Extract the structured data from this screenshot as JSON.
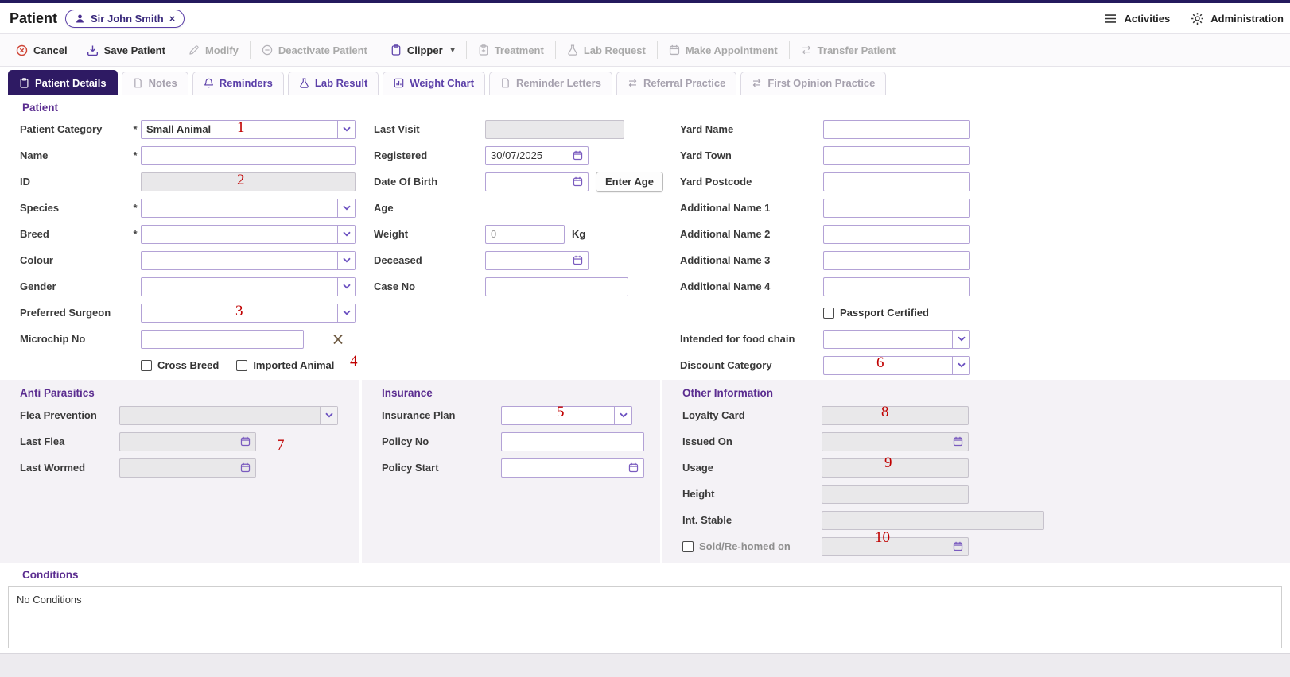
{
  "header": {
    "title": "Patient",
    "patient_chip": {
      "name": "Sir John Smith",
      "close_symbol": "×"
    },
    "activities_label": "Activities",
    "administration_label": "Administration"
  },
  "toolbar": {
    "cancel": "Cancel",
    "save_patient": "Save Patient",
    "modify": "Modify",
    "deactivate_patient": "Deactivate Patient",
    "clipper": "Clipper",
    "clipper_caret": "▾",
    "treatment": "Treatment",
    "lab_request": "Lab Request",
    "make_appointment": "Make Appointment",
    "transfer_patient": "Transfer Patient"
  },
  "tabs": {
    "patient_details": "Patient Details",
    "notes": "Notes",
    "reminders": "Reminders",
    "lab_result": "Lab Result",
    "weight_chart": "Weight Chart",
    "reminder_letters": "Reminder Letters",
    "referral_practice": "Referral Practice",
    "first_opinion_practice": "First Opinion Practice"
  },
  "patient_section": {
    "title": "Patient",
    "required_marker": "*",
    "patient_category": {
      "label": "Patient Category",
      "value": "Small Animal"
    },
    "name": {
      "label": "Name"
    },
    "id": {
      "label": "ID"
    },
    "species": {
      "label": "Species"
    },
    "breed": {
      "label": "Breed"
    },
    "colour": {
      "label": "Colour"
    },
    "gender": {
      "label": "Gender"
    },
    "preferred_surgeon": {
      "label": "Preferred Surgeon"
    },
    "microchip_no": {
      "label": "Microchip No"
    },
    "cross_breed": {
      "label": "Cross Breed"
    },
    "imported_animal": {
      "label": "Imported Animal"
    },
    "last_visit": {
      "label": "Last Visit"
    },
    "registered": {
      "label": "Registered",
      "value": "30/07/2025"
    },
    "date_of_birth": {
      "label": "Date Of Birth"
    },
    "enter_age_button": "Enter Age",
    "age": {
      "label": "Age"
    },
    "weight": {
      "label": "Weight",
      "value": "0",
      "unit": "Kg"
    },
    "deceased": {
      "label": "Deceased"
    },
    "case_no": {
      "label": "Case No"
    },
    "yard_name": {
      "label": "Yard Name"
    },
    "yard_town": {
      "label": "Yard Town"
    },
    "yard_postcode": {
      "label": "Yard Postcode"
    },
    "additional_name_1": {
      "label": "Additional Name 1"
    },
    "additional_name_2": {
      "label": "Additional Name 2"
    },
    "additional_name_3": {
      "label": "Additional Name 3"
    },
    "additional_name_4": {
      "label": "Additional Name 4"
    },
    "passport_certified": {
      "label": "Passport Certified"
    },
    "intended_for_food_chain": {
      "label": "Intended for food chain"
    },
    "discount_category": {
      "label": "Discount Category"
    }
  },
  "anti_parasitics_section": {
    "title": "Anti Parasitics",
    "flea_prevention": {
      "label": "Flea Prevention"
    },
    "last_flea": {
      "label": "Last Flea"
    },
    "last_wormed": {
      "label": "Last Wormed"
    }
  },
  "insurance_section": {
    "title": "Insurance",
    "insurance_plan": {
      "label": "Insurance Plan"
    },
    "policy_no": {
      "label": "Policy No"
    },
    "policy_start": {
      "label": "Policy Start"
    }
  },
  "other_information_section": {
    "title": "Other Information",
    "loyalty_card": {
      "label": "Loyalty Card"
    },
    "issued_on": {
      "label": "Issued On"
    },
    "usage": {
      "label": "Usage"
    },
    "height": {
      "label": "Height"
    },
    "int_stable": {
      "label": "Int. Stable"
    },
    "sold_rehomed_on": {
      "label": "Sold/Re-homed on"
    }
  },
  "conditions_section": {
    "title": "Conditions",
    "content": "No Conditions"
  },
  "annotations": {
    "a1": "1",
    "a2": "2",
    "a3": "3",
    "a4": "4",
    "a5": "5",
    "a6": "6",
    "a7": "7",
    "a8": "8",
    "a9": "9",
    "a10": "10"
  },
  "colors": {
    "accent_purple": "#5b2d90",
    "active_tab_bg": "#2e1a63",
    "annotation_red": "#c00000"
  }
}
